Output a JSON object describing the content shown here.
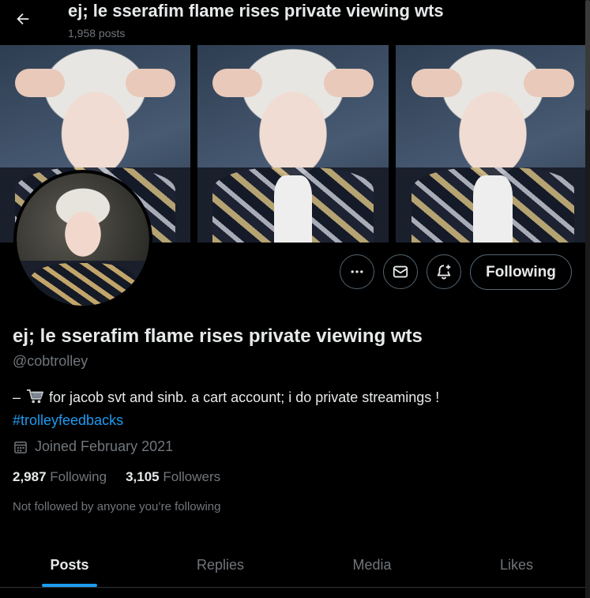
{
  "header": {
    "title": "ej; le sserafim flame rises private viewing wts",
    "post_count": "1,958 posts",
    "back_icon": "arrow-left-icon"
  },
  "banner": {
    "description_icon": "photo-strip",
    "colors": {
      "background": "#2e3d51",
      "hair": "#e8e6e2"
    }
  },
  "actions": {
    "more_icon": "more-horizontal-icon",
    "message_icon": "envelope-icon",
    "notify_icon": "bell-plus-icon",
    "follow_label": "Following"
  },
  "profile": {
    "name": "ej; le sserafim flame rises private viewing wts",
    "handle": "@cobtrolley",
    "bio_prefix": "–",
    "bio_text": "for jacob svt and sinb. a cart account; i do private streamings !",
    "bio_icon": "shopping-cart-icon",
    "hashtag": "#trolleyfeedbacks",
    "joined": "Joined February 2021",
    "joined_icon": "calendar-icon",
    "following_count": "2,987",
    "following_label": "Following",
    "followers_count": "3,105",
    "followers_label": "Followers",
    "not_followed": "Not followed by anyone you’re following"
  },
  "tabs": [
    {
      "label": "Posts",
      "active": true
    },
    {
      "label": "Replies",
      "active": false
    },
    {
      "label": "Media",
      "active": false
    },
    {
      "label": "Likes",
      "active": false
    }
  ],
  "colors": {
    "background": "#000000",
    "text": "#e7e9ea",
    "muted": "#71767b",
    "accent": "#1d9bf0",
    "border": "#536471"
  }
}
